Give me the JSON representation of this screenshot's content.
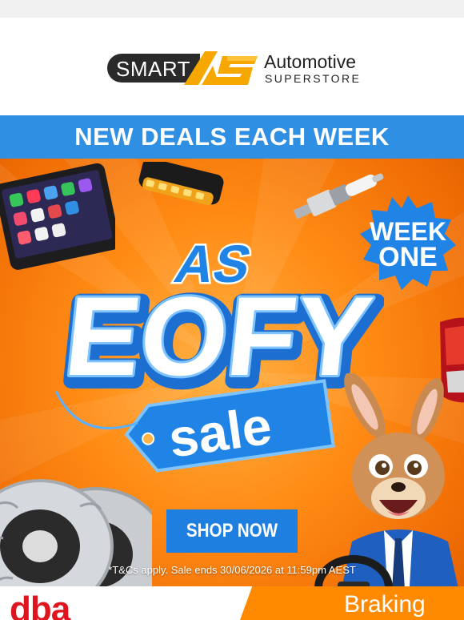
{
  "logo": {
    "smart": "SMART",
    "automotive": "Automotive",
    "superstore": "SUPERSTORE"
  },
  "hero": {
    "banner": "NEW DEALS EACH WEEK",
    "week_line1": "WEEK",
    "week_line2": "ONE",
    "as_mark": "AS",
    "eofy": "EOFY",
    "sale": "sale",
    "cta": "SHOP NOW",
    "terms": "*T&Cs apply. Sale ends 30/06/2026 at 11:59pm AEST"
  },
  "footer": {
    "brand": "dba",
    "category": "Braking"
  },
  "colors": {
    "brand_orange": "#ff8a00",
    "brand_blue": "#2f8fe3",
    "dba_red": "#e0141e",
    "dark": "#2a2a2a"
  },
  "icons": [
    "as-logo-icon",
    "tablet-image",
    "led-light-image",
    "spark-plug-image",
    "brake-rotor-image",
    "kangaroo-mascot-image",
    "tail-light-image"
  ]
}
